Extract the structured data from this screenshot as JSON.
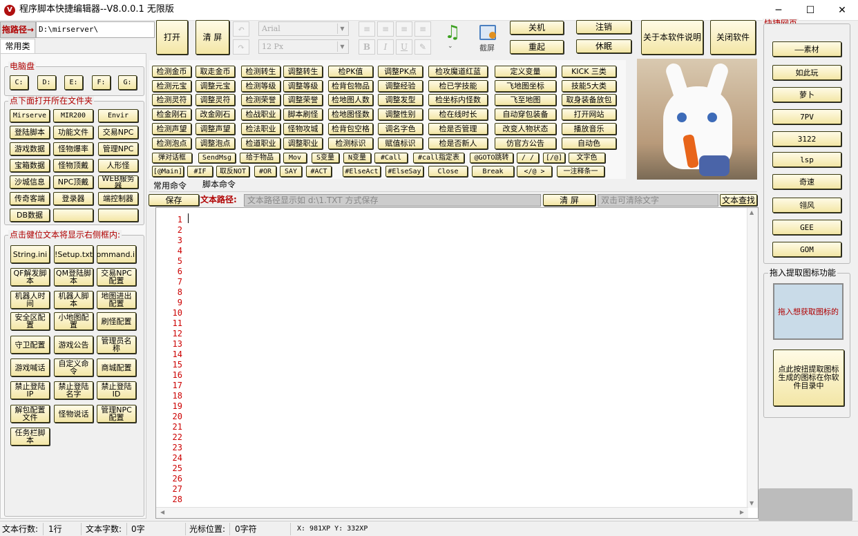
{
  "window": {
    "title": "程序脚本快捷编辑器--V8.0.0.1 无限版",
    "icon": "app-logo-icon",
    "min": "─",
    "max": "☐",
    "close": "✕"
  },
  "left": {
    "path_label": "拖路径→",
    "path_value": "D:\\mirserver\\",
    "tab": "常用类",
    "drive_group": "电脑盘",
    "drives": [
      "C:",
      "D:",
      "E:",
      "F:",
      "G:"
    ],
    "folder_group": "点下面打开所在文件夹",
    "folders": [
      "Mirserve",
      "MIR200",
      "Envir",
      "登陆脚本",
      "功能文件",
      "交易NPC",
      "游戏数据",
      "怪物爆率",
      "管理NPC",
      "宝箱数据",
      "怪物顶戴",
      "人形怪",
      "沙城信息",
      "NPC顶戴",
      "WEB服务器",
      "传奇客端",
      "登录器",
      "端控制器",
      "DB数据",
      "",
      ""
    ],
    "config_group": "点击健位文本将显示右侧框内:",
    "configs": [
      "String.ini",
      "!Setup.txt",
      "Command.ini",
      "QF解发脚本",
      "QM登陆脚本",
      "交易NPC配置",
      "机器人时间",
      "机器人脚本",
      "地图进出配置",
      "安全区配置",
      "小地图配置",
      "刷怪配置",
      "守卫配置",
      "游戏公告",
      "管理员名称",
      "游戏喊话",
      "自定义命令",
      "商城配置",
      "禁止登陆IP",
      "禁止登陆名字",
      "禁止登陆ID",
      "解包配置文件",
      "怪物说话",
      "管理NPC配置",
      "任务栏脚本"
    ]
  },
  "toolbar": {
    "open": "打开",
    "clear": "清 屏",
    "font_name": "Arial",
    "font_size": "12 Px",
    "bold": "B",
    "italic": "I",
    "underline": "U",
    "music_icon": "music-note-icon",
    "screenshot": "截屏",
    "shutdown": "关机",
    "restart": "重起",
    "logout": "注销",
    "sleep": "休眠",
    "about": "关于本软件说明",
    "close_app": "关闭软件"
  },
  "commands": {
    "col1": [
      "检测金币",
      "检测元宝",
      "检测灵符",
      "检金刚石",
      "检测声望",
      "检测泡点"
    ],
    "col2": [
      "取走金币",
      "调整元宝",
      "调整灵符",
      "改金刚石",
      "调整声望",
      "调整泡点"
    ],
    "col3": [
      "检测转生",
      "检测等级",
      "检测荣誉",
      "检战职业",
      "检法职业",
      "检道职业"
    ],
    "col4": [
      "调整转生",
      "调整等级",
      "调整荣誉",
      "脚本刷怪",
      "怪物攻城",
      "调整职业"
    ],
    "col5": [
      "检PK值",
      "检背包物品",
      "检地图人数",
      "检地图怪数",
      "检背包空格",
      "检测标识"
    ],
    "col6": [
      "调整PK点",
      "调整经验",
      "调整发型",
      "调整性别",
      "调名字色",
      "赋值标识"
    ],
    "col7": [
      "检攻魔道红蓝",
      "检已学技能",
      "检坐标内怪数",
      "检在线时长",
      "检是否管理",
      "检是否新人"
    ],
    "col8": [
      "定义变量",
      "飞地图坐标",
      "飞至地图",
      "自动穿包装备",
      "改变人物状态",
      "仿官方公告"
    ],
    "col9": [
      "KICK 三类",
      "技能5大类",
      "取身装备放包",
      "打开网站",
      "播放音乐",
      "自动色"
    ],
    "row7": [
      "弹对话框",
      "SendMsg",
      "给于物品",
      "Mov",
      "S变量",
      "N变量",
      "#Call",
      "#call指定表",
      "@GOTO跳转",
      "/ /",
      "[/@]",
      "文字色"
    ],
    "row8": [
      "[@Main]",
      "#IF",
      "取反NOT",
      "#OR",
      "SAY",
      "#ACT",
      "#ElseAct",
      "#ElseSay",
      "Close",
      "Break",
      "</@ >",
      "一注释条一"
    ]
  },
  "tabs": [
    "常用命令",
    "脚本命令"
  ],
  "pathbar": {
    "save": "保存",
    "label": "文本路径:",
    "placeholder": "文本路径显示如 d:\\1.TXT 方式保存",
    "clear": "清 屏",
    "search_placeholder": "双击可清除文字",
    "search": "文本查找"
  },
  "editor": {
    "lines": [
      "1",
      "2",
      "3",
      "4",
      "5",
      "6",
      "7",
      "8",
      "9",
      "10",
      "11",
      "12",
      "13",
      "14",
      "15",
      "16",
      "17",
      "18",
      "19",
      "20",
      "21",
      "22",
      "23",
      "24",
      "25",
      "26",
      "27",
      "28"
    ]
  },
  "right": {
    "group": "快捷网页",
    "sites": [
      "——素材",
      "如此玩",
      "萝卜",
      "7PV",
      "3122",
      "lsp",
      "奇速",
      "翎风",
      "GEE",
      "GOM"
    ],
    "icon_group": "拖入提取图标功能",
    "drop_text": "拖入想获取图标的",
    "extract": "点此按扭提取图标生成的图标在你软件目录中"
  },
  "status": {
    "lines_label": "文本行数:",
    "lines_value": "1行",
    "chars_label": "文本字数:",
    "chars_value": "0字",
    "cursor_label": "光标位置:",
    "cursor_value": "0字符",
    "coords": "X: 981XP  Y: 332XP"
  }
}
